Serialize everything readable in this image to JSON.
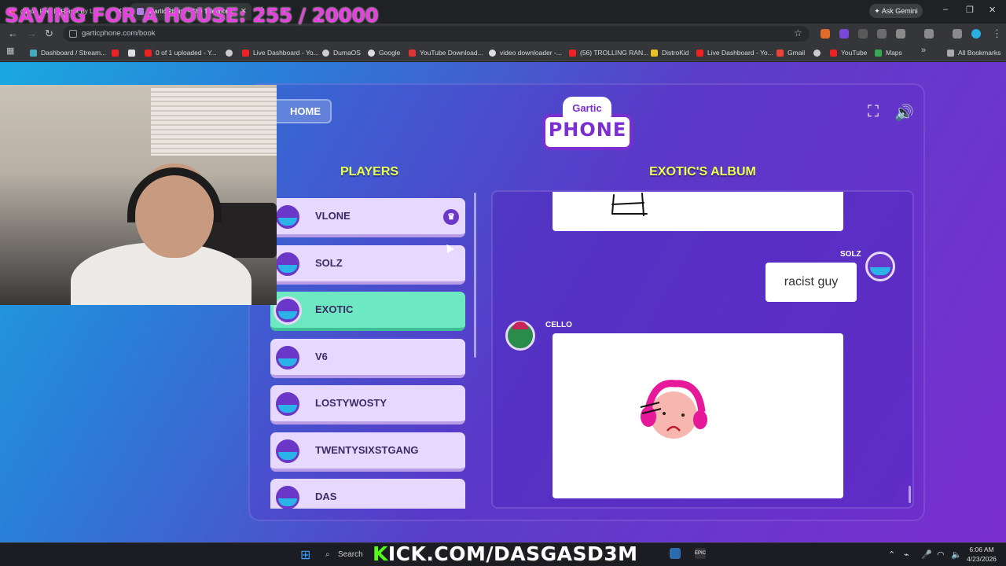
{
  "overlay": {
    "title": "SAVING FOR A HOUSE: 255 / 20000",
    "kick": "KICK.COM/DASGASD3M"
  },
  "browser": {
    "tabs": [
      {
        "label": "d4vd - Feel It (Remix By L..."
      },
      {
        "label": "Gartic Phone - The Telephon..."
      }
    ],
    "url": "garticphone.com/book",
    "ask_gemini": "Ask Gemini",
    "all_bookmarks": "All Bookmarks",
    "bookmarks": [
      {
        "label": "Dashboard / Stream..."
      },
      {
        "label": "0 of 1 uploaded - Y..."
      },
      {
        "label": "Live Dashboard - Yo..."
      },
      {
        "label": "DumaOS"
      },
      {
        "label": "Google"
      },
      {
        "label": "YouTube Download..."
      },
      {
        "label": "video downloader -..."
      },
      {
        "label": "(56) TROLLING RAN..."
      },
      {
        "label": "DistroKid"
      },
      {
        "label": "Live Dashboard - Yo..."
      },
      {
        "label": "Gmail"
      },
      {
        "label": "YouTube"
      },
      {
        "label": "Maps"
      }
    ]
  },
  "game": {
    "home_label": "HOME",
    "logo_top": "Gartic",
    "logo_bottom": "PHONE",
    "players_heading": "PLAYERS",
    "album_heading": "EXOTIC'S ALBUM",
    "players": [
      {
        "name": "VLONE",
        "host": true
      },
      {
        "name": "SOLZ"
      },
      {
        "name": "EXOTIC",
        "active": true
      },
      {
        "name": "V6"
      },
      {
        "name": "LOSTYWOSTY"
      },
      {
        "name": "TWENTYSIXSTGANG"
      },
      {
        "name": "DAS"
      }
    ],
    "album": {
      "solz_label": "SOLZ",
      "solz_text": "racist guy",
      "cello_label": "CELLO"
    }
  },
  "taskbar": {
    "search_label": "Search",
    "time": "6:06 AM",
    "date": "4/23/2026"
  }
}
